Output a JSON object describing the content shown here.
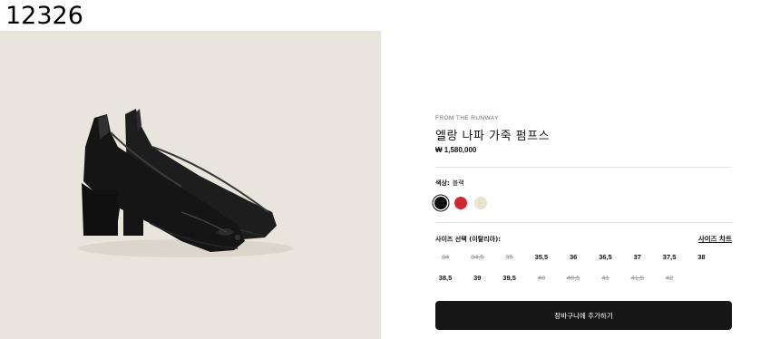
{
  "page_id": "12326",
  "product": {
    "eyebrow": "FROM THE RUNWAY",
    "title": "엘랑 나파 가죽 펌프스",
    "price": "₩ 1,580,000"
  },
  "color": {
    "label": "색상:",
    "selected": "블랙",
    "swatches": [
      {
        "name": "black",
        "hex": "#0d0d0d",
        "selected": true
      },
      {
        "name": "red",
        "hex": "#d22630",
        "selected": false
      },
      {
        "name": "cream",
        "hex": "#ece3cf",
        "selected": false
      }
    ]
  },
  "size": {
    "label": "사이즈 선택 (이탈리아):",
    "chart_link": "사이즈 차트",
    "rows": [
      [
        {
          "value": "34",
          "available": false
        },
        {
          "value": "34,5",
          "available": false
        },
        {
          "value": "35",
          "available": false
        },
        {
          "value": "35,5",
          "available": true
        },
        {
          "value": "36",
          "available": true
        },
        {
          "value": "36,5",
          "available": true
        },
        {
          "value": "37",
          "available": true
        },
        {
          "value": "37,5",
          "available": true
        },
        {
          "value": "38",
          "available": true
        }
      ],
      [
        {
          "value": "38,5",
          "available": true
        },
        {
          "value": "39",
          "available": true
        },
        {
          "value": "39,5",
          "available": true
        },
        {
          "value": "40",
          "available": false
        },
        {
          "value": "40,5",
          "available": false
        },
        {
          "value": "41",
          "available": false
        },
        {
          "value": "41,5",
          "available": false
        },
        {
          "value": "42",
          "available": false
        }
      ]
    ]
  },
  "cart_button": "장바구니에 추가하기",
  "image": {
    "icon": "product-photo-pumps",
    "background": "#e9e4dc"
  }
}
